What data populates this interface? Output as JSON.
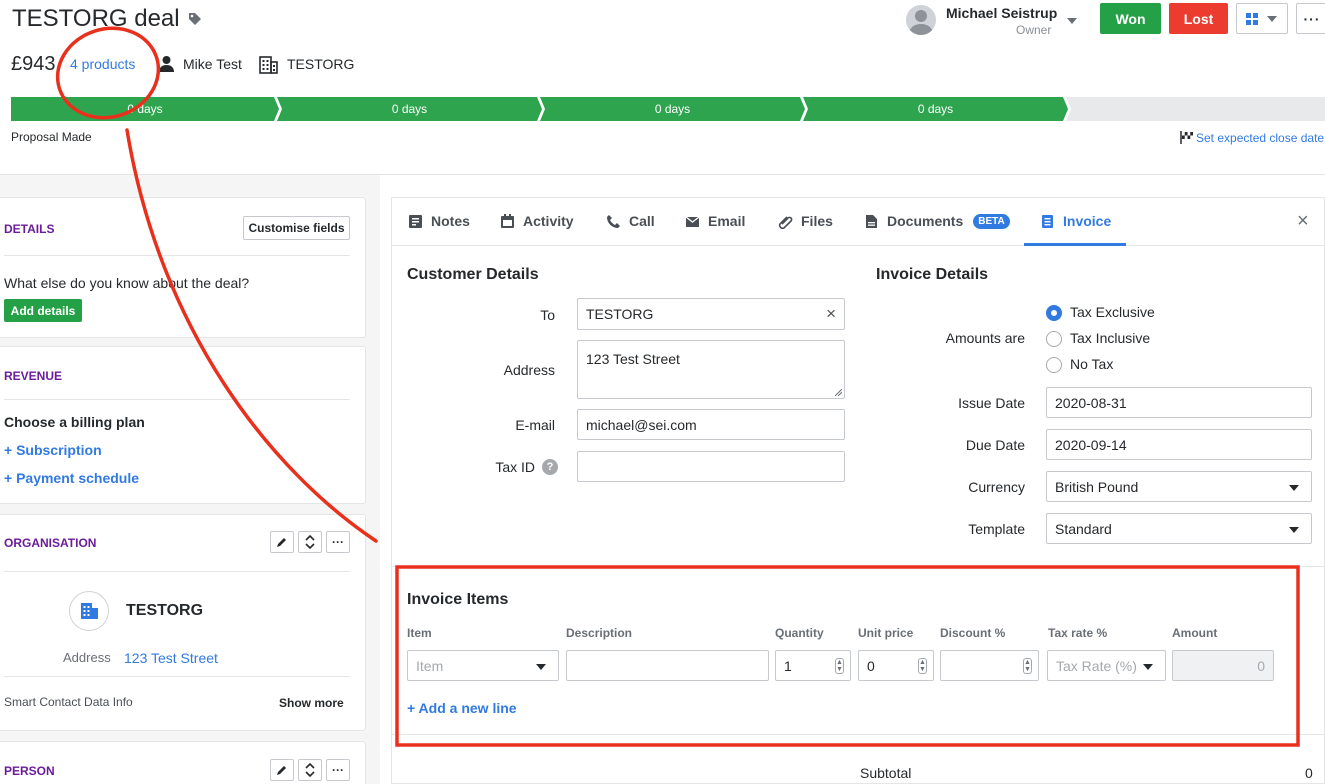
{
  "header": {
    "deal_title": "TESTORG deal",
    "value": "£943",
    "products_link": "4 products",
    "person_name": "Mike Test",
    "org_name": "TESTORG",
    "owner_name": "Michael Seistrup",
    "owner_role": "Owner",
    "won_label": "Won",
    "lost_label": "Lost",
    "more_label": "···"
  },
  "pipeline": {
    "stages": [
      "0 days",
      "0 days",
      "0 days",
      "0 days"
    ],
    "stage_name": "Proposal Made",
    "close_date_link": "Set expected close date",
    "completed_stages": 4,
    "total_stages": 5,
    "active_color": "#2ea44f",
    "inactive_color": "#e8e9ea"
  },
  "sidebar": {
    "details": {
      "title": "DETAILS",
      "customise_button": "Customise fields",
      "prompt": "What else do you know about the deal?",
      "add_button": "Add details"
    },
    "revenue": {
      "title": "REVENUE",
      "heading": "Choose a billing plan",
      "subscription_link": "+ Subscription",
      "payment_link": "+ Payment schedule"
    },
    "organisation": {
      "title": "ORGANISATION",
      "name": "TESTORG",
      "address_label": "Address",
      "address_value": "123 Test Street",
      "smart_data_label": "Smart Contact Data Info",
      "show_more": "Show more"
    },
    "person": {
      "title": "PERSON"
    }
  },
  "tabs": {
    "notes": "Notes",
    "activity": "Activity",
    "call": "Call",
    "email": "Email",
    "files": "Files",
    "documents": "Documents",
    "beta_badge": "BETA",
    "invoice": "Invoice",
    "close": "×"
  },
  "customer": {
    "title": "Customer Details",
    "to_label": "To",
    "to_value": "TESTORG",
    "address_label": "Address",
    "address_value": "123 Test Street",
    "email_label": "E-mail",
    "email_value": "michael@sei.com",
    "taxid_label": "Tax ID",
    "taxid_value": ""
  },
  "invoice_details": {
    "title": "Invoice Details",
    "amounts_label": "Amounts are",
    "options": [
      "Tax Exclusive",
      "Tax Inclusive",
      "No Tax"
    ],
    "selected_option": "Tax Exclusive",
    "issue_label": "Issue Date",
    "issue_value": "2020-08-31",
    "due_label": "Due Date",
    "due_value": "2020-09-14",
    "currency_label": "Currency",
    "currency_value": "British Pound",
    "template_label": "Template",
    "template_value": "Standard"
  },
  "items": {
    "title": "Invoice Items",
    "headers": [
      "Item",
      "Description",
      "Quantity",
      "Unit price",
      "Discount %",
      "Tax rate %",
      "Amount"
    ],
    "row": {
      "item_placeholder": "Item",
      "description": "",
      "quantity": "1",
      "unit_price": "0",
      "discount": "",
      "tax_placeholder": "Tax Rate (%)",
      "amount": "0"
    },
    "add_line": "+ Add a new line",
    "subtotal_label": "Subtotal",
    "subtotal_value": "0"
  },
  "colors": {
    "link": "#317ae2",
    "won": "#24a146",
    "lost": "#eb3c2f",
    "section_title": "#6b1c9c",
    "annotation_red": "#e8301c"
  }
}
